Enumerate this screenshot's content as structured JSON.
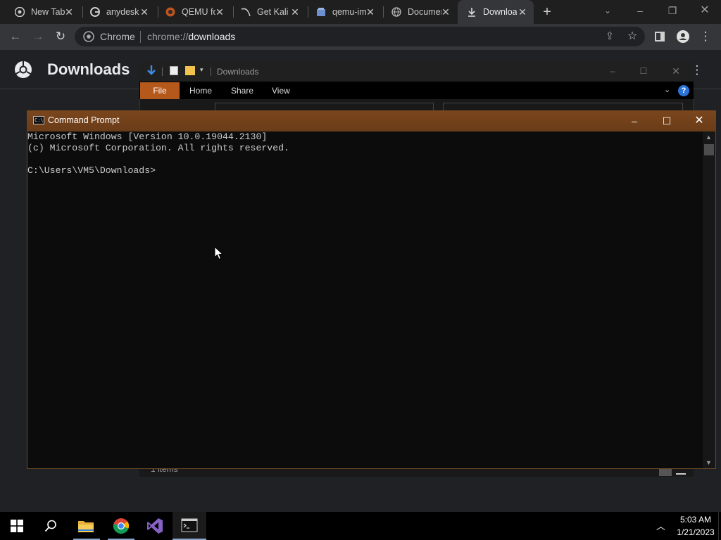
{
  "browser": {
    "tabs": [
      {
        "title": "New Tab",
        "icon": "chrome-icon",
        "active": false
      },
      {
        "title": "anydesk",
        "icon": "google-icon",
        "active": false
      },
      {
        "title": "QEMU for",
        "icon": "qemu-icon",
        "active": false
      },
      {
        "title": "Get Kali",
        "icon": "kali-icon",
        "active": false
      },
      {
        "title": "qemu-img",
        "icon": "document-icon",
        "active": false
      },
      {
        "title": "Documentation",
        "icon": "globe-icon",
        "active": false
      },
      {
        "title": "Downloads",
        "icon": "download-icon",
        "active": true
      }
    ],
    "omnibox": {
      "site": "Chrome",
      "url_prefix": "chrome://",
      "url_host": "downloads"
    },
    "page_title": "Downloads"
  },
  "explorer": {
    "title": "Downloads",
    "ribbon_tabs": [
      "File",
      "Home",
      "Share",
      "View"
    ],
    "status": "1 items"
  },
  "cmd": {
    "title": "Command Prompt",
    "lines": [
      "Microsoft Windows [Version 10.0.19044.2130]",
      "(c) Microsoft Corporation. All rights reserved.",
      "",
      "C:\\Users\\VM5\\Downloads>"
    ]
  },
  "taskbar": {
    "time": "5:03 AM",
    "date": "1/21/2023",
    "apps": [
      "start-icon",
      "search-icon",
      "file-explorer-icon",
      "chrome-icon",
      "visual-studio-icon",
      "command-prompt-icon"
    ]
  },
  "colors": {
    "cmd_accent": "#7a461d",
    "file_tab": "#b5581c",
    "taskbar": "#000000"
  }
}
